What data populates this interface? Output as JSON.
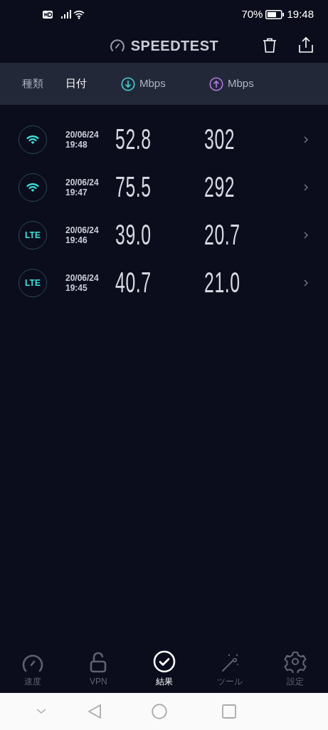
{
  "status_bar": {
    "battery_percent": "70%",
    "time": "19:48"
  },
  "app_bar": {
    "title": "SPEEDTEST"
  },
  "columns": [
    {
      "kind": "text",
      "label": "種類",
      "selected": false
    },
    {
      "kind": "text",
      "label": "日付",
      "selected": true
    },
    {
      "kind": "download",
      "label": "Mbps",
      "selected": false
    },
    {
      "kind": "upload",
      "label": "Mbps",
      "selected": false
    }
  ],
  "results": [
    {
      "kind": "wifi",
      "date": "20/06/24",
      "time": "19:48",
      "download": "52.8",
      "upload": "302"
    },
    {
      "kind": "wifi",
      "date": "20/06/24",
      "time": "19:47",
      "download": "75.5",
      "upload": "292"
    },
    {
      "kind": "lte",
      "network_label": "LTE",
      "date": "20/06/24",
      "time": "19:46",
      "download": "39.0",
      "upload": "20.7"
    },
    {
      "kind": "lte",
      "network_label": "LTE",
      "date": "20/06/24",
      "time": "19:45",
      "download": "40.7",
      "upload": "21.0"
    }
  ],
  "bottom_nav": [
    {
      "kind": "speed",
      "label": "速度",
      "selected": false
    },
    {
      "kind": "vpn",
      "label": "VPN",
      "selected": false
    },
    {
      "kind": "results",
      "label": "結果",
      "selected": true
    },
    {
      "kind": "tools",
      "label": "ツール",
      "selected": false
    },
    {
      "kind": "settings",
      "label": "設定",
      "selected": false
    }
  ]
}
